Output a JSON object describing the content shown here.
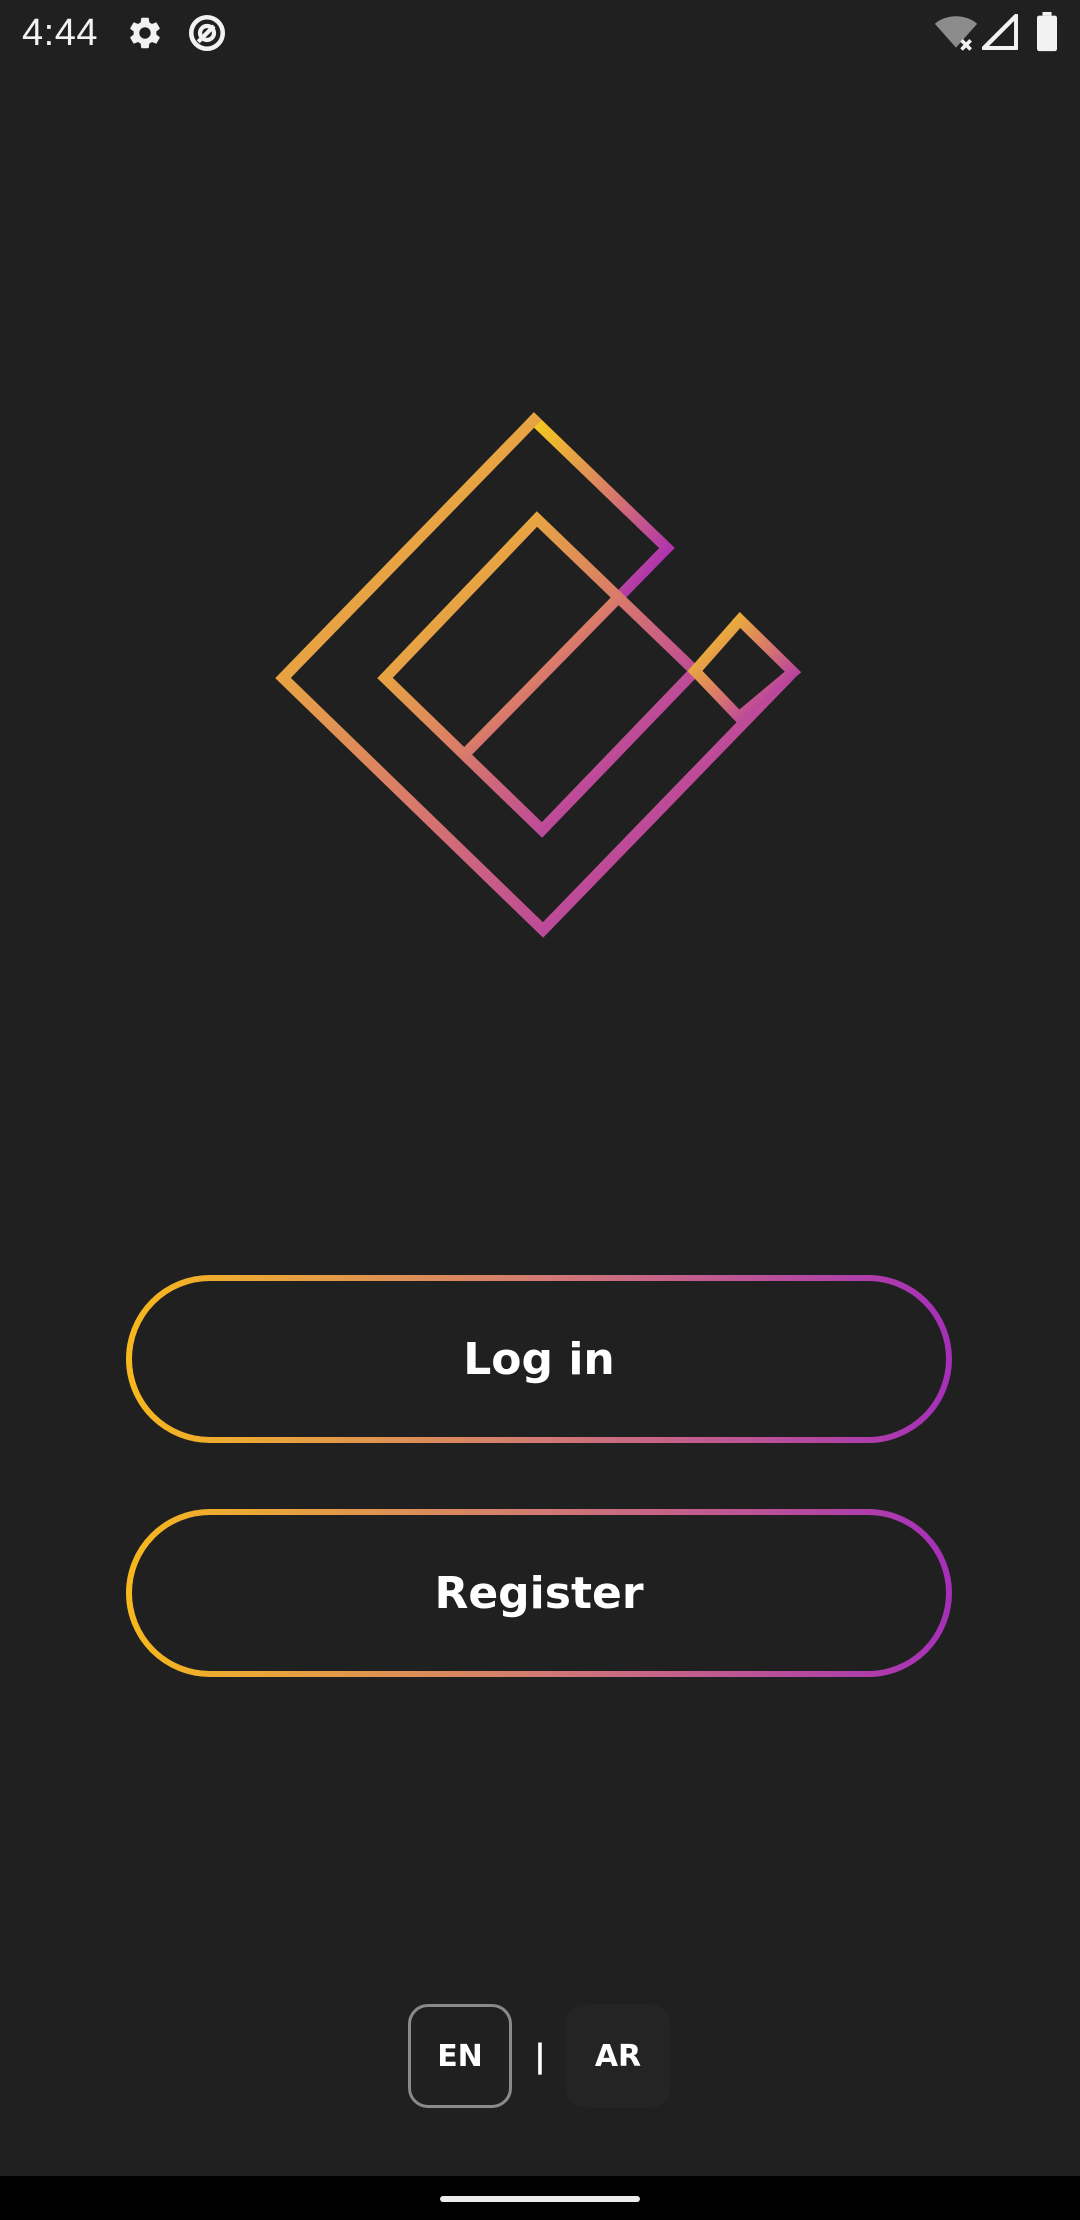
{
  "status_bar": {
    "time": "4:44",
    "icons": [
      "gear-icon",
      "data-saver-icon",
      "wifi-off-icon",
      "signal-icon",
      "battery-icon"
    ]
  },
  "logo": {
    "icon": "diamond-logo-icon",
    "gradient": [
      "#f5cc1b",
      "#d97a6a",
      "#a21cc4"
    ]
  },
  "buttons": {
    "login_label": "Log in",
    "register_label": "Register",
    "border_gradient": [
      "#f6b81d",
      "#d27a72",
      "#a62fb8"
    ]
  },
  "language": {
    "en_label": "EN",
    "separator": "|",
    "ar_label": "AR",
    "selected": "EN"
  },
  "colors": {
    "background": "#202020",
    "nav_bar": "#000000",
    "text": "#ffffff"
  }
}
